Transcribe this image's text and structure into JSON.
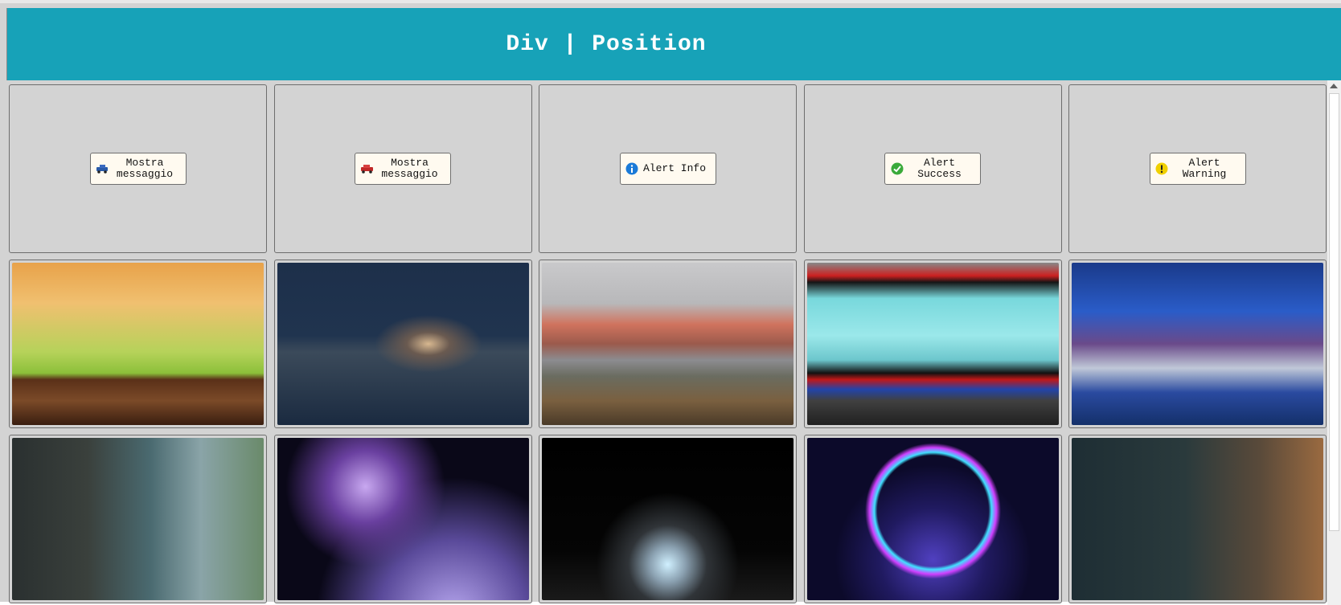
{
  "header": {
    "title": "Div | Position"
  },
  "buttons": [
    {
      "label": "Mostra messaggio",
      "icon": "blue-car-icon"
    },
    {
      "label": "Mostra messaggio",
      "icon": "red-car-icon"
    },
    {
      "label": "Alert Info",
      "icon": "info-icon"
    },
    {
      "label": "Alert Success",
      "icon": "check-icon"
    },
    {
      "label": "Alert Warning",
      "icon": "warning-icon"
    }
  ],
  "images": [
    "autumn-forest-wood-table",
    "starry-night-lake-sailboat",
    "red-mountain-fjord",
    "tv-studio-cyan-screens",
    "news-studio-blue",
    "autumn-leaves-tree",
    "purple-galaxy-planet",
    "dark-podium-neon-ring",
    "neon-circle-podium",
    "dark-room-podium"
  ],
  "colors": {
    "header": "#17a2b8",
    "panel": "#d3d3d3",
    "button_bg": "#fffaf0"
  }
}
